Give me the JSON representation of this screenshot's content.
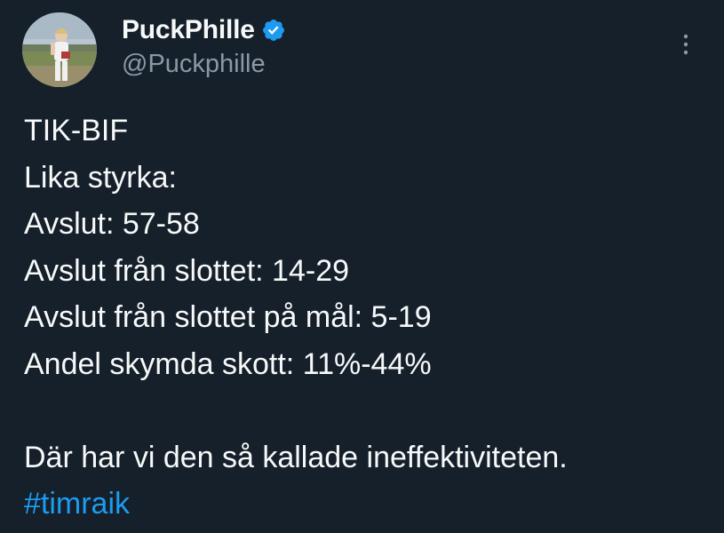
{
  "author": {
    "display_name": "PuckPhille",
    "handle": "@Puckphille",
    "verified": true,
    "avatar_icon": "profile-photo"
  },
  "more_icon": "more-options-icon",
  "tweet": {
    "lines": [
      "TIK-BIF",
      "Lika styrka:",
      "Avslut: 57-58",
      "Avslut från slottet: 14-29",
      "Avslut från slottet på mål: 5-19",
      "Andel skymda skott: 11%-44%"
    ],
    "closing": "Där har vi den så kallade ineffektiviteten.",
    "hashtag": "#timraik"
  },
  "colors": {
    "background": "#15202b",
    "text": "#f7f9f9",
    "secondary_text": "#8b98a5",
    "link": "#1d9bf0",
    "verified": "#1d9bf0"
  }
}
